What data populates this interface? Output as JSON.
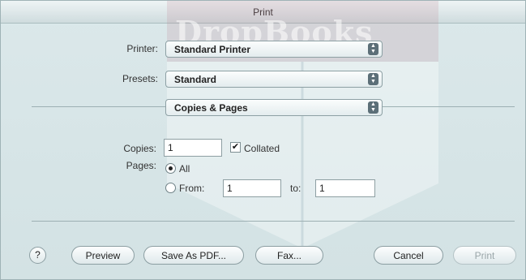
{
  "window": {
    "title": "Print"
  },
  "watermark": {
    "text": "DropBooks"
  },
  "printer": {
    "label": "Printer:",
    "value": "Standard Printer"
  },
  "presets": {
    "label": "Presets:",
    "value": "Standard"
  },
  "panel": {
    "value": "Copies & Pages"
  },
  "copies": {
    "label": "Copies:",
    "value": "1",
    "collated_label": "Collated",
    "collated_checked": true
  },
  "pages": {
    "label": "Pages:",
    "all_label": "All",
    "from_label": "From:",
    "from_value": "1",
    "to_label": "to:",
    "to_value": "1",
    "selected": "All"
  },
  "buttons": {
    "help": "?",
    "preview": "Preview",
    "save_pdf": "Save As PDF...",
    "fax": "Fax...",
    "cancel": "Cancel",
    "print": "Print"
  },
  "colors": {
    "background": "#d6e4e6",
    "watermark": "#be788c"
  }
}
